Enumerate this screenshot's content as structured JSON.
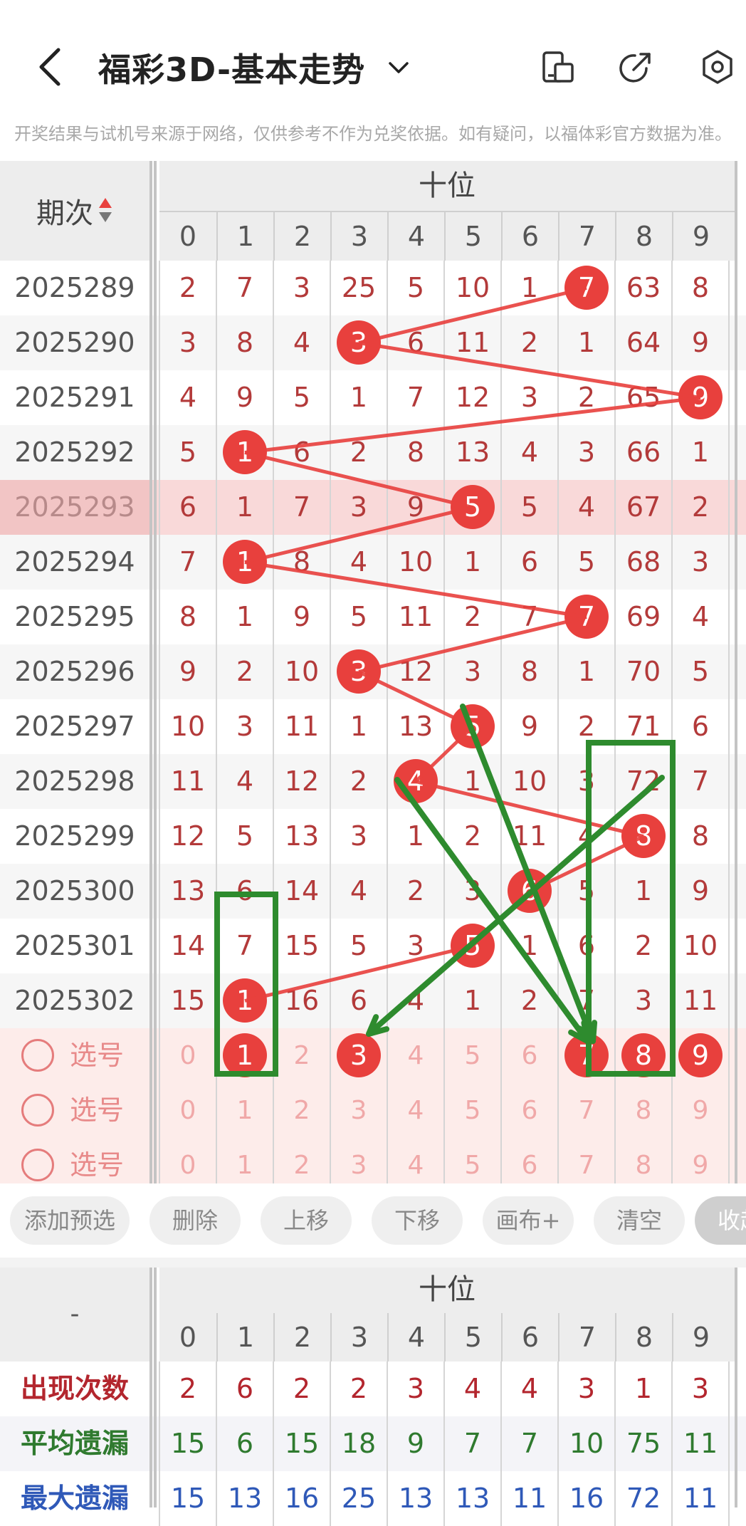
{
  "header": {
    "title": "福彩3D-基本走势",
    "notice": "开奖结果与试机号来源于网络，仅供参考不作为兑奖依据。如有疑问，以福体彩官方数据为准。",
    "icons": [
      "back-arrow-icon",
      "chevron-down-icon",
      "phone-layout-icon",
      "share-icon",
      "settings-gear-icon"
    ]
  },
  "table": {
    "period_header": "期次",
    "section_header": "十位",
    "digits": [
      "0",
      "1",
      "2",
      "3",
      "4",
      "5",
      "6",
      "7",
      "8",
      "9"
    ],
    "rows": [
      {
        "period": "2025289",
        "hit": 7,
        "cells": [
          "2",
          "7",
          "3",
          "25",
          "5",
          "10",
          "1",
          "7",
          "63",
          "8"
        ]
      },
      {
        "period": "2025290",
        "hit": 3,
        "cells": [
          "3",
          "8",
          "4",
          "3",
          "6",
          "11",
          "2",
          "1",
          "64",
          "9"
        ]
      },
      {
        "period": "2025291",
        "hit": 9,
        "cells": [
          "4",
          "9",
          "5",
          "1",
          "7",
          "12",
          "3",
          "2",
          "65",
          "9"
        ]
      },
      {
        "period": "2025292",
        "hit": 1,
        "cells": [
          "5",
          "1",
          "6",
          "2",
          "8",
          "13",
          "4",
          "3",
          "66",
          "1"
        ]
      },
      {
        "period": "2025293",
        "hit": 5,
        "cells": [
          "6",
          "1",
          "7",
          "3",
          "9",
          "5",
          "5",
          "4",
          "67",
          "2"
        ]
      },
      {
        "period": "2025294",
        "hit": 1,
        "cells": [
          "7",
          "1",
          "8",
          "4",
          "10",
          "1",
          "6",
          "5",
          "68",
          "3"
        ]
      },
      {
        "period": "2025295",
        "hit": 7,
        "cells": [
          "8",
          "1",
          "9",
          "5",
          "11",
          "2",
          "7",
          "7",
          "69",
          "4"
        ]
      },
      {
        "period": "2025296",
        "hit": 3,
        "cells": [
          "9",
          "2",
          "10",
          "3",
          "12",
          "3",
          "8",
          "1",
          "70",
          "5"
        ]
      },
      {
        "period": "2025297",
        "hit": 5,
        "cells": [
          "10",
          "3",
          "11",
          "1",
          "13",
          "5",
          "9",
          "2",
          "71",
          "6"
        ]
      },
      {
        "period": "2025298",
        "hit": 4,
        "cells": [
          "11",
          "4",
          "12",
          "2",
          "4",
          "1",
          "10",
          "3",
          "72",
          "7"
        ]
      },
      {
        "period": "2025299",
        "hit": 8,
        "cells": [
          "12",
          "5",
          "13",
          "3",
          "1",
          "2",
          "11",
          "4",
          "8",
          "8"
        ]
      },
      {
        "period": "2025300",
        "hit": 6,
        "cells": [
          "13",
          "6",
          "14",
          "4",
          "2",
          "3",
          "6",
          "5",
          "1",
          "9"
        ]
      },
      {
        "period": "2025301",
        "hit": 5,
        "cells": [
          "14",
          "7",
          "15",
          "5",
          "3",
          "5",
          "1",
          "6",
          "2",
          "10"
        ]
      },
      {
        "period": "2025302",
        "hit": 1,
        "cells": [
          "15",
          "1",
          "16",
          "6",
          "4",
          "1",
          "2",
          "7",
          "3",
          "11"
        ]
      }
    ],
    "pick_rows": [
      {
        "label": "选号",
        "digits": [
          "0",
          "1",
          "2",
          "3",
          "4",
          "5",
          "6",
          "7",
          "8",
          "9"
        ],
        "selected": [
          1,
          3,
          7,
          8,
          9
        ]
      },
      {
        "label": "选号",
        "digits": [
          "0",
          "1",
          "2",
          "3",
          "4",
          "5",
          "6",
          "7",
          "8",
          "9"
        ],
        "selected": []
      },
      {
        "label": "选号",
        "digits": [
          "0",
          "1",
          "2",
          "3",
          "4",
          "5",
          "6",
          "7",
          "8",
          "9"
        ],
        "selected": []
      }
    ]
  },
  "actions": [
    {
      "label": "添加预选"
    },
    {
      "label": "删除"
    },
    {
      "label": "上移"
    },
    {
      "label": "下移"
    },
    {
      "label": "画布+"
    },
    {
      "label": "清空"
    },
    {
      "label": "收起"
    }
  ],
  "stats": {
    "left_header": "-",
    "section_header": "十位",
    "digits": [
      "0",
      "1",
      "2",
      "3",
      "4",
      "5",
      "6",
      "7",
      "8",
      "9"
    ],
    "rows": [
      {
        "label": "出现次数",
        "color": "#b3262e",
        "values": [
          "2",
          "6",
          "2",
          "2",
          "3",
          "4",
          "4",
          "3",
          "1",
          "3"
        ]
      },
      {
        "label": "平均遗漏",
        "color": "#2f7a2f",
        "values": [
          "15",
          "6",
          "15",
          "18",
          "9",
          "7",
          "7",
          "10",
          "75",
          "11"
        ]
      },
      {
        "label": "最大遗漏",
        "color": "#2f59b8",
        "values": [
          "15",
          "13",
          "16",
          "25",
          "13",
          "13",
          "11",
          "16",
          "72",
          "11"
        ]
      }
    ]
  },
  "colors": {
    "ball": "#e8403d",
    "cell_text": "#b33a3a",
    "highlight_row": "#f9d9d9",
    "pick_bg": "#fdecea",
    "green_mark": "#2e8b2e"
  }
}
